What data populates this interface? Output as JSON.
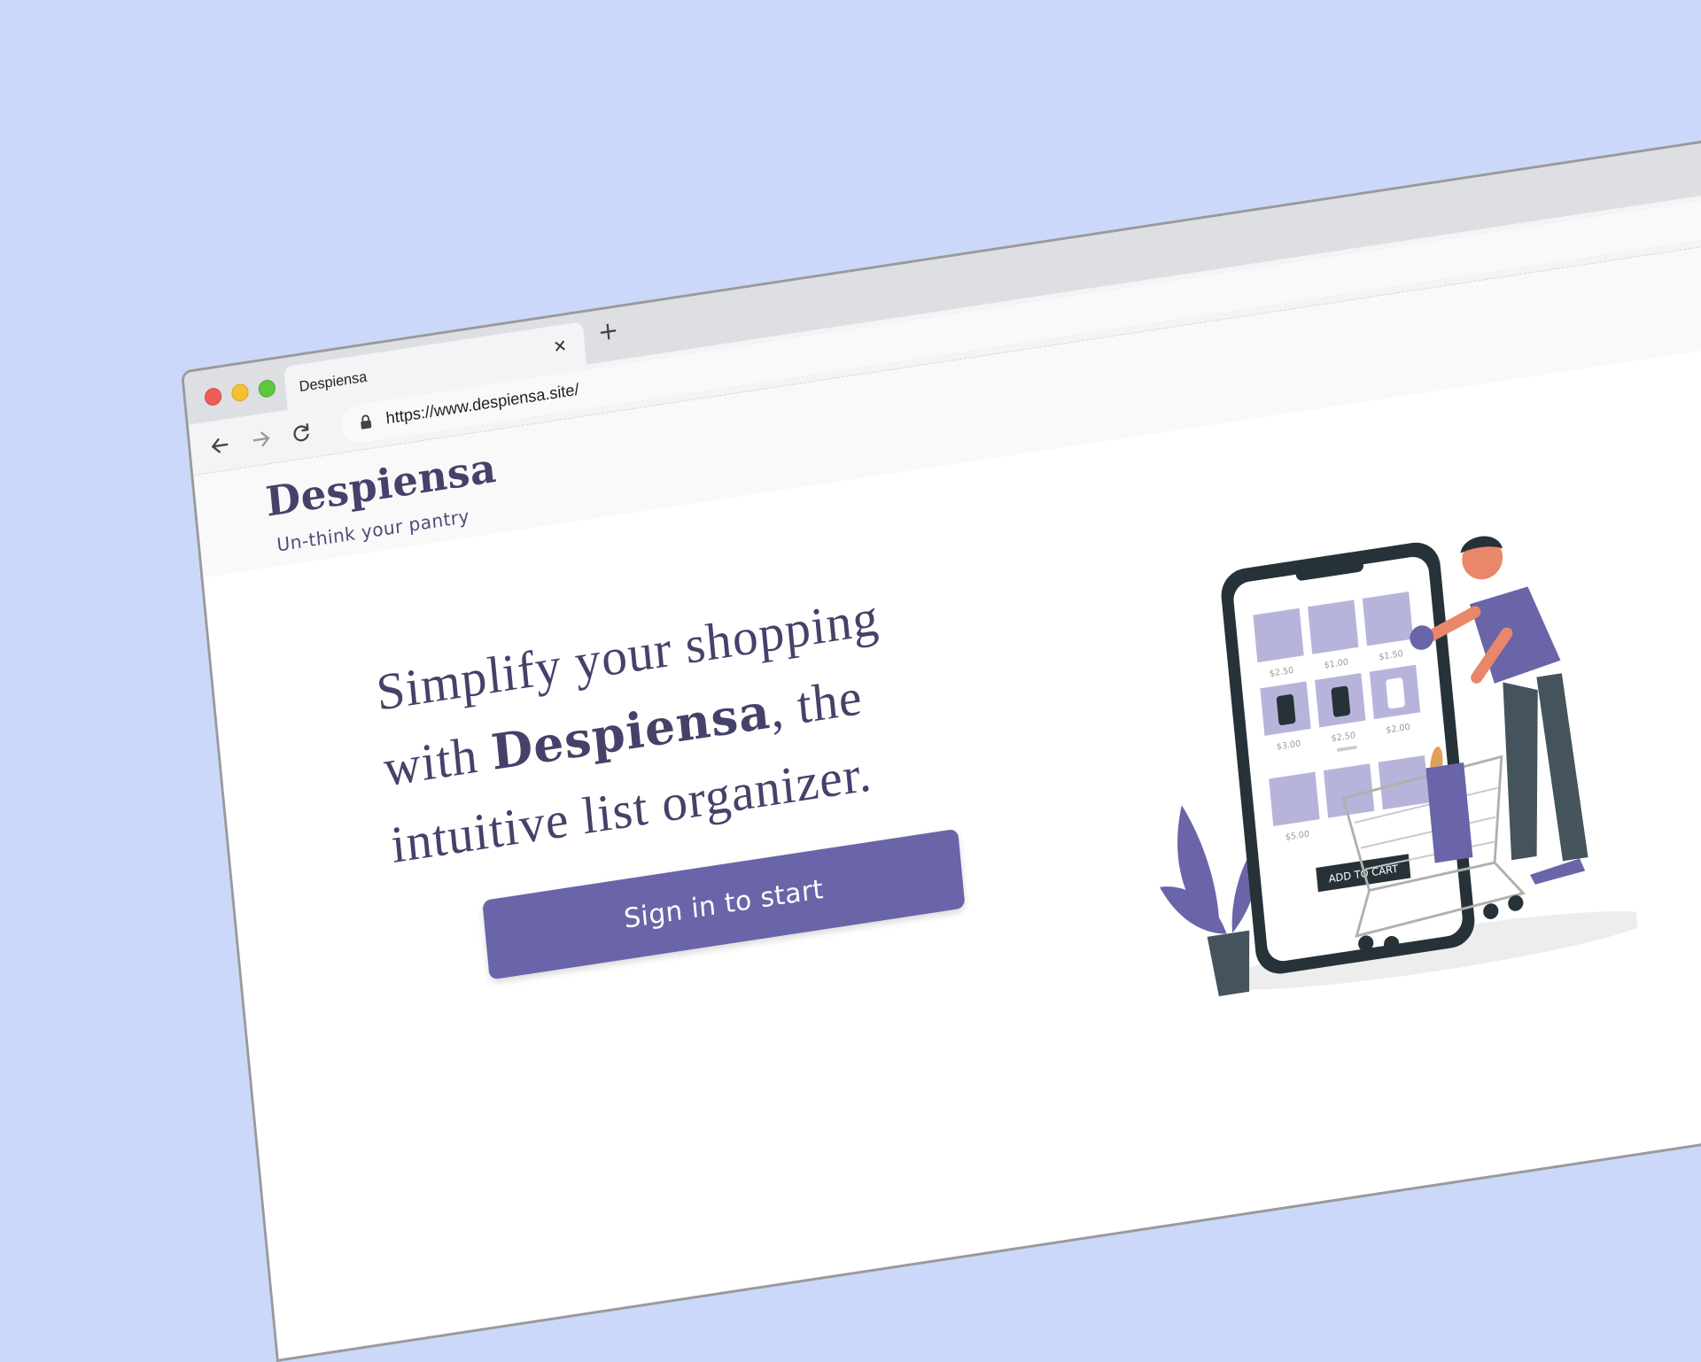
{
  "browser": {
    "tab_title": "Despiensa",
    "url": "https://www.despiensa.site/"
  },
  "app": {
    "brand": "Despiensa",
    "tagline": "Un-think your pantry"
  },
  "hero": {
    "headline_pre": "Simplify your shopping with ",
    "headline_bold": "Despiensa",
    "headline_post": ", the intuitive list organizer.",
    "cta_label": "Sign in to start"
  },
  "illustration": {
    "prices": [
      "$2.50",
      "$1.00",
      "$1.50",
      "$3.00",
      "$2.50",
      "$2.00",
      "$5.00"
    ],
    "add_to_cart": "ADD TO CART"
  },
  "colors": {
    "background": "#cbd8f9",
    "brand_text": "#45426a",
    "accent": "#6a64a8",
    "illustration_tile": "#b7b4dc"
  }
}
